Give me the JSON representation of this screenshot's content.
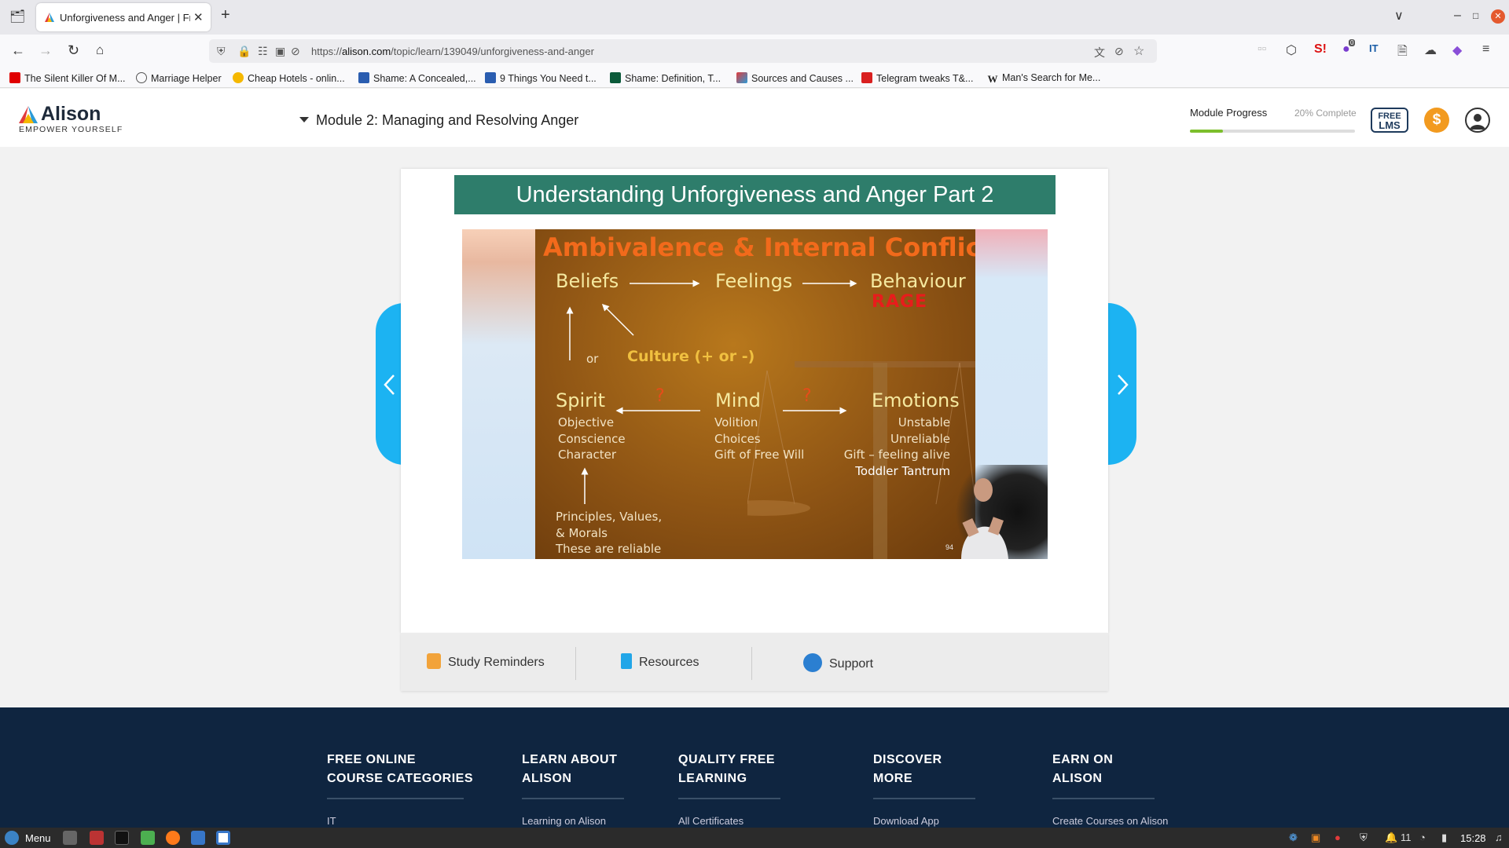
{
  "browser": {
    "tab_title": "Unforgiveness and Anger | Fr",
    "new_tab_symbol": "+",
    "url_host": "alison.com",
    "url_prefix": "https://",
    "url_path": "/topic/learn/139049/unforgiveness-and-anger",
    "notification_count": "0",
    "bookmarks": [
      {
        "label": "The Silent Killer Of M...",
        "icon": "youtube-icon",
        "color": "#e00000"
      },
      {
        "label": "Marriage Helper",
        "icon": "globe-icon",
        "color": "#555555"
      },
      {
        "label": "Cheap Hotels - onlin...",
        "icon": "hotel-icon",
        "color": "#1a1a1a"
      },
      {
        "label": "Shame: A Concealed,...",
        "icon": "pt-icon",
        "color": "#2a5db0"
      },
      {
        "label": "9 Things You Need t...",
        "icon": "pt-icon",
        "color": "#2a5db0"
      },
      {
        "label": "Shame: Definition, T...",
        "icon": "v-icon",
        "color": "#0b5a3a"
      },
      {
        "label": "Sources and Causes ...",
        "icon": "alison-icon",
        "color": "#e0542a"
      },
      {
        "label": "Telegram tweaks T&...",
        "icon": "red-square-icon",
        "color": "#d92020"
      },
      {
        "label": "Man's Search for Me...",
        "icon": "wikipedia-icon",
        "color": "#333333"
      }
    ]
  },
  "header": {
    "logo_name": "Alison",
    "logo_tagline": "EMPOWER YOURSELF",
    "module_title": "Module 2: Managing and Resolving Anger",
    "progress_label": "Module Progress",
    "progress_text": "20% Complete",
    "progress_value": 0.2,
    "free_lms_line1": "FREE",
    "free_lms_line2": "LMS",
    "coin_symbol": "$"
  },
  "lesson": {
    "banner_title": "Understanding Unforgiveness and Anger Part 2",
    "slide": {
      "title": "Ambivalence & Internal Conflict",
      "beliefs": "Beliefs",
      "feelings": "Feelings",
      "behaviour": "Behaviour",
      "rage": "RAGE",
      "or": "or",
      "culture": "Culture (+ or -)",
      "spirit": "Spirit",
      "mind": "Mind",
      "emotions": "Emotions",
      "question": "?",
      "spirit_items": [
        "Objective",
        "Conscience",
        "Character"
      ],
      "mind_items": [
        "Volition",
        "Choices",
        "Gift of Free Will"
      ],
      "emotions_items": [
        "Unstable",
        "Unreliable",
        "Gift – feeling alive"
      ],
      "toddler": "Toddler Tantrum",
      "principles": [
        "Principles, Values,",
        "& Morals",
        "These are reliable"
      ],
      "page_number": "94"
    }
  },
  "tools": {
    "study_reminders": "Study Reminders",
    "resources": "Resources",
    "support": "Support"
  },
  "footer": {
    "columns": [
      {
        "line1": "FREE ONLINE",
        "line2": "COURSE CATEGORIES",
        "link": "IT"
      },
      {
        "line1": "LEARN ABOUT",
        "line2": "ALISON",
        "link": "Learning on Alison"
      },
      {
        "line1": "QUALITY FREE",
        "line2": "LEARNING",
        "link": "All Certificates"
      },
      {
        "line1": "DISCOVER",
        "line2": "MORE",
        "link": "Download App"
      },
      {
        "line1": "EARN ON",
        "line2": "ALISON",
        "link": "Create Courses on Alison"
      }
    ]
  },
  "taskbar": {
    "menu_label": "Menu",
    "tray_count": "11",
    "clock": "15:28"
  },
  "colors": {
    "banner": "#2e7d6b",
    "nav_arrows": "#1cb3f2",
    "footer": "#0f2540",
    "progress": "#7cbf2c",
    "coin": "#f29a1f"
  }
}
